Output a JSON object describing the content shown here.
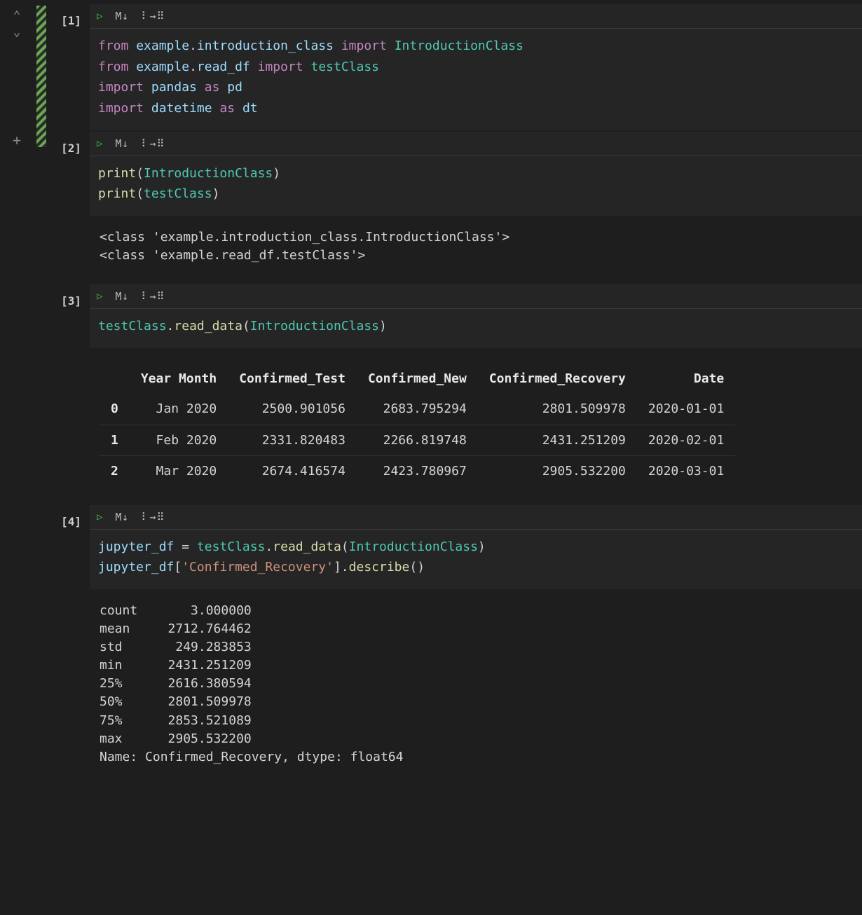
{
  "gutter": {
    "arrow_up": "⌃",
    "arrow_down": "⌄",
    "plus": "+"
  },
  "toolbar": {
    "run": "▷",
    "markdown": "M↓",
    "snippet": "⠇→⠿"
  },
  "cells": [
    {
      "label": "[1]",
      "code_html": "<span class='kw'>from</span> <span class='nm'>example</span><span class='pn'>.</span><span class='nm'>introduction_class</span> <span class='kw'>import</span> <span class='cls'>IntroductionClass</span>\n<span class='kw'>from</span> <span class='nm'>example</span><span class='pn'>.</span><span class='nm'>read_df</span> <span class='kw'>import</span> <span class='cls'>testClass</span>\n<span class='kw'>import</span> <span class='nm'>pandas</span> <span class='kw'>as</span> <span class='nm'>pd</span>\n<span class='kw'>import</span> <span class='nm'>datetime</span> <span class='kw'>as</span> <span class='nm'>dt</span>"
    },
    {
      "label": "[2]",
      "code_html": "<span class='fn2'>print</span><span class='pn'>(</span><span class='cls'>IntroductionClass</span><span class='pn'>)</span>\n<span class='fn2'>print</span><span class='pn'>(</span><span class='cls'>testClass</span><span class='pn'>)</span>",
      "output_text": "<class 'example.introduction_class.IntroductionClass'>\n<class 'example.read_df.testClass'>"
    },
    {
      "label": "[3]",
      "code_html": "<span class='cls'>testClass</span><span class='pn'>.</span><span class='fn2'>read_data</span><span class='pn'>(</span><span class='cls'>IntroductionClass</span><span class='pn'>)</span>",
      "table": {
        "columns": [
          "",
          "Year Month",
          "Confirmed_Test",
          "Confirmed_New",
          "Confirmed_Recovery",
          "Date"
        ],
        "rows": [
          [
            "0",
            "Jan 2020",
            "2500.901056",
            "2683.795294",
            "2801.509978",
            "2020-01-01"
          ],
          [
            "1",
            "Feb 2020",
            "2331.820483",
            "2266.819748",
            "2431.251209",
            "2020-02-01"
          ],
          [
            "2",
            "Mar 2020",
            "2674.416574",
            "2423.780967",
            "2905.532200",
            "2020-03-01"
          ]
        ]
      }
    },
    {
      "label": "[4]",
      "code_html": "<span class='nm'>jupyter_df</span> <span class='pn'>=</span> <span class='cls'>testClass</span><span class='pn'>.</span><span class='fn2'>read_data</span><span class='pn'>(</span><span class='cls'>IntroductionClass</span><span class='pn'>)</span>\n<span class='nm'>jupyter_df</span><span class='pn'>[</span><span class='str'>'Confirmed_Recovery'</span><span class='pn'>].</span><span class='fn2'>describe</span><span class='pn'>()</span>",
      "output_text": "count       3.000000\nmean     2712.764462\nstd       249.283853\nmin      2431.251209\n25%      2616.380594\n50%      2801.509978\n75%      2853.521089\nmax      2905.532200\nName: Confirmed_Recovery, dtype: float64"
    }
  ]
}
